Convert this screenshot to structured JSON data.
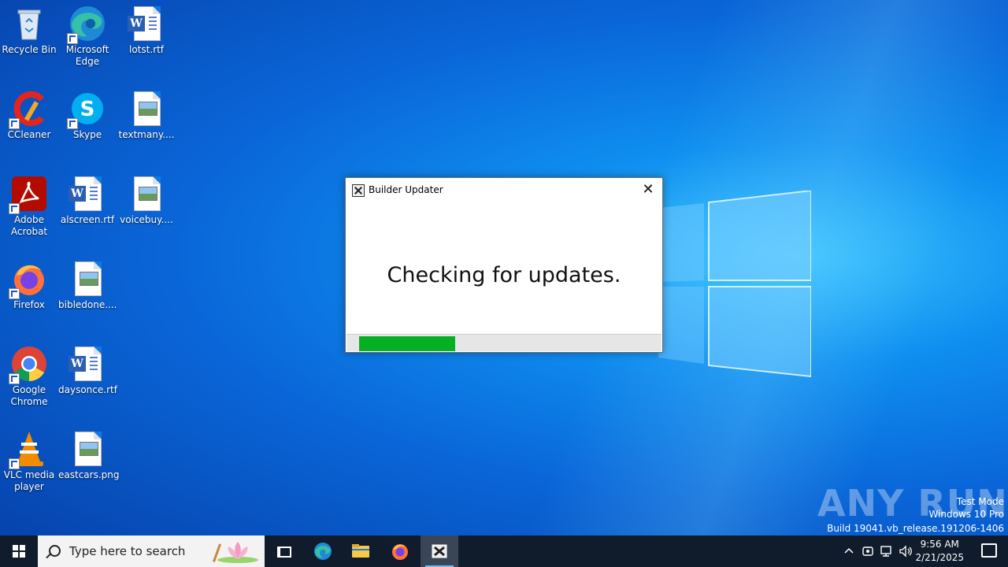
{
  "desktop": {
    "icons": [
      {
        "label": "Recycle Bin"
      },
      {
        "label": "Microsoft Edge"
      },
      {
        "label": "lotst.rtf"
      },
      {
        "label": "CCleaner"
      },
      {
        "label": "Skype"
      },
      {
        "label": "textmany...."
      },
      {
        "label": "Adobe Acrobat"
      },
      {
        "label": "alscreen.rtf"
      },
      {
        "label": "voicebuy...."
      },
      {
        "label": "Firefox"
      },
      {
        "label": "bibledone...."
      },
      {
        "label": "Google Chrome"
      },
      {
        "label": "daysonce.rtf"
      },
      {
        "label": "VLC media player"
      },
      {
        "label": "eastcars.png"
      }
    ]
  },
  "dialog": {
    "title": "Builder Updater",
    "close_label": "✕",
    "message": "Checking for updates.",
    "progress": 0.32,
    "progress_color": "#06b025"
  },
  "watermark": {
    "brand": "ANY RUN",
    "line1": "Test Mode",
    "line2": "Windows 10 Pro",
    "line3": "Build 19041.vb_release.191206-1406"
  },
  "taskbar": {
    "search_placeholder": "Type here to search",
    "apps": [
      "edge-icon",
      "file-explorer-icon",
      "firefox-icon",
      "builder-updater-icon"
    ],
    "clock_time": "9:56 AM",
    "clock_date": "2/21/2025"
  },
  "colors": {
    "taskbar": "#101b2b",
    "accent": "#0a66d8"
  }
}
